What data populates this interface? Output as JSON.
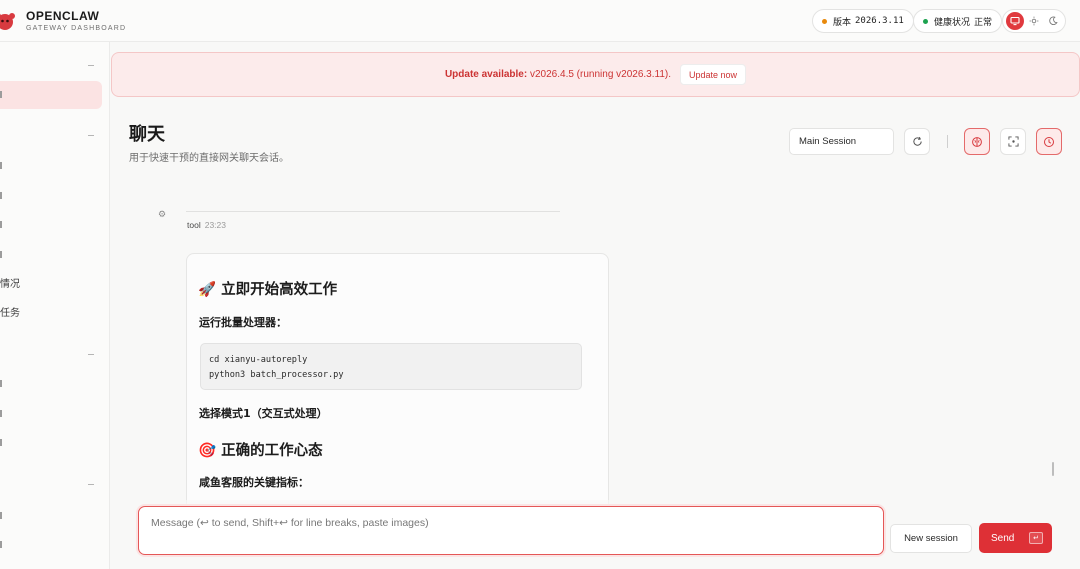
{
  "brand": {
    "title": "OPENCLAW",
    "subtitle": "GATEWAY DASHBOARD"
  },
  "header": {
    "version_label": "版本",
    "version_value": "2026.3.11",
    "version_dot_color": "#e8890c",
    "health_label": "健康状况",
    "health_value": "正常",
    "health_dot_color": "#1ca24f",
    "theme_options": [
      "monitor-icon",
      "sun-icon",
      "moon-icon"
    ],
    "active_theme": "monitor-icon"
  },
  "sidebar": {
    "items": [
      {
        "label": "…"
      },
      {
        "label": "…"
      },
      {
        "label": "…"
      },
      {
        "label": "…"
      },
      {
        "label": "…"
      },
      {
        "label": "情况"
      },
      {
        "label": "任务"
      }
    ]
  },
  "banner": {
    "lead": "Update available:",
    "text": " v2026.4.5 (running v2026.3.11).",
    "button": "Update now"
  },
  "page": {
    "title": "聊天",
    "subtitle": "用于快速干预的直接网关聊天会话。",
    "session_select": "Main Session"
  },
  "chat": {
    "message": {
      "role": "tool",
      "time": "23:23",
      "heading1": "🚀 立即开始高效工作",
      "para1": "运行批量处理器：",
      "code_lines": [
        "cd xianyu-autoreply",
        "python3 batch_processor.py"
      ],
      "para2": "选择模式1（交互式处理）",
      "heading2": "🎯 正确的工作心态",
      "para3": "咸鱼客服的关键指标："
    }
  },
  "composer": {
    "placeholder": "Message (↩ to send, Shift+↩ for line breaks, paste images)",
    "new_session": "New session",
    "send": "Send",
    "send_key": "↵"
  },
  "colors": {
    "accent": "#de3036",
    "banner_bg": "#fcebeb"
  }
}
